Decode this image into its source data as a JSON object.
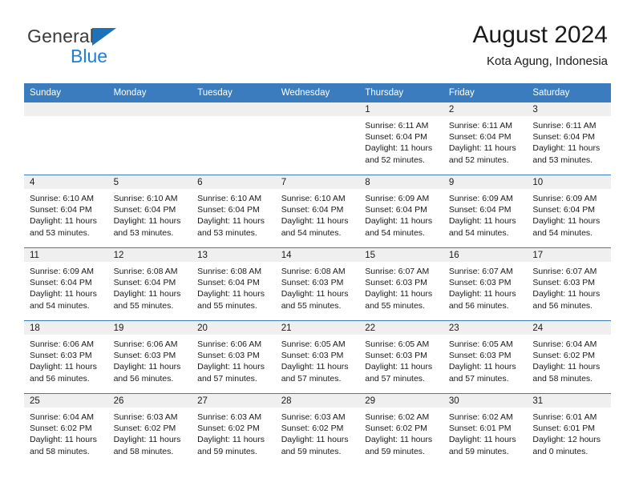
{
  "brand": {
    "name_top": "General",
    "name_bottom": "Blue",
    "mark": "triangle-logo",
    "accent_color": "#1e7fd4",
    "header_color": "#3a7cbe"
  },
  "header": {
    "title": "August 2024",
    "location": "Kota Agung, Indonesia"
  },
  "weekdays": [
    "Sunday",
    "Monday",
    "Tuesday",
    "Wednesday",
    "Thursday",
    "Friday",
    "Saturday"
  ],
  "labels": {
    "sunrise_prefix": "Sunrise:",
    "sunset_prefix": "Sunset:",
    "daylight_prefix": "Daylight:"
  },
  "weeks": [
    [
      {
        "day": "",
        "empty": true
      },
      {
        "day": "",
        "empty": true
      },
      {
        "day": "",
        "empty": true
      },
      {
        "day": "",
        "empty": true
      },
      {
        "day": "1",
        "sunrise": "Sunrise: 6:11 AM",
        "sunset": "Sunset: 6:04 PM",
        "daylight": "Daylight: 11 hours and 52 minutes."
      },
      {
        "day": "2",
        "sunrise": "Sunrise: 6:11 AM",
        "sunset": "Sunset: 6:04 PM",
        "daylight": "Daylight: 11 hours and 52 minutes."
      },
      {
        "day": "3",
        "sunrise": "Sunrise: 6:11 AM",
        "sunset": "Sunset: 6:04 PM",
        "daylight": "Daylight: 11 hours and 53 minutes."
      }
    ],
    [
      {
        "day": "4",
        "sunrise": "Sunrise: 6:10 AM",
        "sunset": "Sunset: 6:04 PM",
        "daylight": "Daylight: 11 hours and 53 minutes."
      },
      {
        "day": "5",
        "sunrise": "Sunrise: 6:10 AM",
        "sunset": "Sunset: 6:04 PM",
        "daylight": "Daylight: 11 hours and 53 minutes."
      },
      {
        "day": "6",
        "sunrise": "Sunrise: 6:10 AM",
        "sunset": "Sunset: 6:04 PM",
        "daylight": "Daylight: 11 hours and 53 minutes."
      },
      {
        "day": "7",
        "sunrise": "Sunrise: 6:10 AM",
        "sunset": "Sunset: 6:04 PM",
        "daylight": "Daylight: 11 hours and 54 minutes."
      },
      {
        "day": "8",
        "sunrise": "Sunrise: 6:09 AM",
        "sunset": "Sunset: 6:04 PM",
        "daylight": "Daylight: 11 hours and 54 minutes."
      },
      {
        "day": "9",
        "sunrise": "Sunrise: 6:09 AM",
        "sunset": "Sunset: 6:04 PM",
        "daylight": "Daylight: 11 hours and 54 minutes."
      },
      {
        "day": "10",
        "sunrise": "Sunrise: 6:09 AM",
        "sunset": "Sunset: 6:04 PM",
        "daylight": "Daylight: 11 hours and 54 minutes."
      }
    ],
    [
      {
        "day": "11",
        "sunrise": "Sunrise: 6:09 AM",
        "sunset": "Sunset: 6:04 PM",
        "daylight": "Daylight: 11 hours and 54 minutes."
      },
      {
        "day": "12",
        "sunrise": "Sunrise: 6:08 AM",
        "sunset": "Sunset: 6:04 PM",
        "daylight": "Daylight: 11 hours and 55 minutes."
      },
      {
        "day": "13",
        "sunrise": "Sunrise: 6:08 AM",
        "sunset": "Sunset: 6:04 PM",
        "daylight": "Daylight: 11 hours and 55 minutes."
      },
      {
        "day": "14",
        "sunrise": "Sunrise: 6:08 AM",
        "sunset": "Sunset: 6:03 PM",
        "daylight": "Daylight: 11 hours and 55 minutes."
      },
      {
        "day": "15",
        "sunrise": "Sunrise: 6:07 AM",
        "sunset": "Sunset: 6:03 PM",
        "daylight": "Daylight: 11 hours and 55 minutes."
      },
      {
        "day": "16",
        "sunrise": "Sunrise: 6:07 AM",
        "sunset": "Sunset: 6:03 PM",
        "daylight": "Daylight: 11 hours and 56 minutes."
      },
      {
        "day": "17",
        "sunrise": "Sunrise: 6:07 AM",
        "sunset": "Sunset: 6:03 PM",
        "daylight": "Daylight: 11 hours and 56 minutes."
      }
    ],
    [
      {
        "day": "18",
        "sunrise": "Sunrise: 6:06 AM",
        "sunset": "Sunset: 6:03 PM",
        "daylight": "Daylight: 11 hours and 56 minutes."
      },
      {
        "day": "19",
        "sunrise": "Sunrise: 6:06 AM",
        "sunset": "Sunset: 6:03 PM",
        "daylight": "Daylight: 11 hours and 56 minutes."
      },
      {
        "day": "20",
        "sunrise": "Sunrise: 6:06 AM",
        "sunset": "Sunset: 6:03 PM",
        "daylight": "Daylight: 11 hours and 57 minutes."
      },
      {
        "day": "21",
        "sunrise": "Sunrise: 6:05 AM",
        "sunset": "Sunset: 6:03 PM",
        "daylight": "Daylight: 11 hours and 57 minutes."
      },
      {
        "day": "22",
        "sunrise": "Sunrise: 6:05 AM",
        "sunset": "Sunset: 6:03 PM",
        "daylight": "Daylight: 11 hours and 57 minutes."
      },
      {
        "day": "23",
        "sunrise": "Sunrise: 6:05 AM",
        "sunset": "Sunset: 6:03 PM",
        "daylight": "Daylight: 11 hours and 57 minutes."
      },
      {
        "day": "24",
        "sunrise": "Sunrise: 6:04 AM",
        "sunset": "Sunset: 6:02 PM",
        "daylight": "Daylight: 11 hours and 58 minutes."
      }
    ],
    [
      {
        "day": "25",
        "sunrise": "Sunrise: 6:04 AM",
        "sunset": "Sunset: 6:02 PM",
        "daylight": "Daylight: 11 hours and 58 minutes."
      },
      {
        "day": "26",
        "sunrise": "Sunrise: 6:03 AM",
        "sunset": "Sunset: 6:02 PM",
        "daylight": "Daylight: 11 hours and 58 minutes."
      },
      {
        "day": "27",
        "sunrise": "Sunrise: 6:03 AM",
        "sunset": "Sunset: 6:02 PM",
        "daylight": "Daylight: 11 hours and 59 minutes."
      },
      {
        "day": "28",
        "sunrise": "Sunrise: 6:03 AM",
        "sunset": "Sunset: 6:02 PM",
        "daylight": "Daylight: 11 hours and 59 minutes."
      },
      {
        "day": "29",
        "sunrise": "Sunrise: 6:02 AM",
        "sunset": "Sunset: 6:02 PM",
        "daylight": "Daylight: 11 hours and 59 minutes."
      },
      {
        "day": "30",
        "sunrise": "Sunrise: 6:02 AM",
        "sunset": "Sunset: 6:01 PM",
        "daylight": "Daylight: 11 hours and 59 minutes."
      },
      {
        "day": "31",
        "sunrise": "Sunrise: 6:01 AM",
        "sunset": "Sunset: 6:01 PM",
        "daylight": "Daylight: 12 hours and 0 minutes."
      }
    ]
  ]
}
